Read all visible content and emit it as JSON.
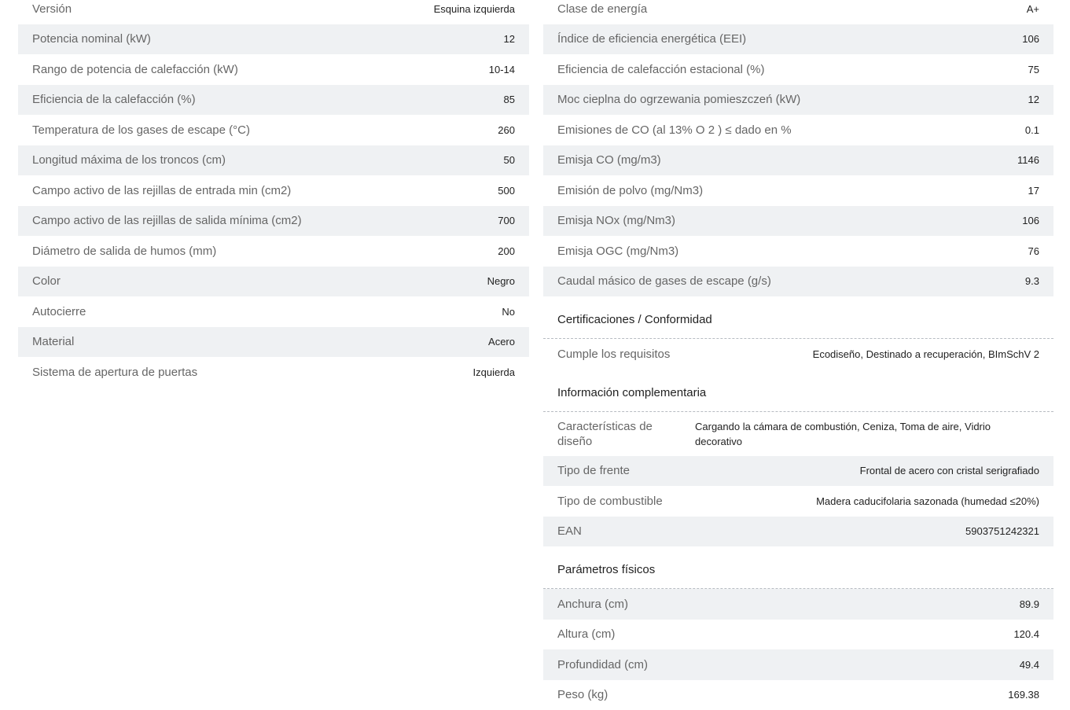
{
  "left_specs": [
    {
      "label": "Versión",
      "value": "Esquina izquierda"
    },
    {
      "label": "Potencia nominal (kW)",
      "value": "12"
    },
    {
      "label": "Rango de potencia de calefacción (kW)",
      "value": "10-14"
    },
    {
      "label": "Eficiencia de la calefacción (%)",
      "value": "85"
    },
    {
      "label": "Temperatura de los gases de escape (°C)",
      "value": "260"
    },
    {
      "label": "Longitud máxima de los troncos (cm)",
      "value": "50"
    },
    {
      "label": "Campo activo de las rejillas de entrada min (cm2)",
      "value": "500"
    },
    {
      "label": "Campo activo de las rejillas de salida mínima (cm2)",
      "value": "700"
    },
    {
      "label": "Diámetro de salida de humos (mm)",
      "value": "200"
    },
    {
      "label": "Color",
      "value": "Negro"
    },
    {
      "label": "Autocierre",
      "value": "No"
    },
    {
      "label": "Material",
      "value": "Acero"
    },
    {
      "label": "Sistema de apertura de puertas",
      "value": "Izquierda"
    }
  ],
  "right_specs": [
    {
      "label": "Clase de energía",
      "value": "A+"
    },
    {
      "label": "Índice de eficiencia energética (EEI)",
      "value": "106"
    },
    {
      "label": "Eficiencia de calefacción estacional (%)",
      "value": "75"
    },
    {
      "label": "Moc cieplna do ogrzewania pomieszczeń (kW)",
      "value": "12"
    },
    {
      "label": "Emisiones de CO (al 13% O 2 ) ≤ dado en %",
      "value": "0.1"
    },
    {
      "label": "Emisja CO (mg/m3)",
      "value": "1146"
    },
    {
      "label": "Emisión de polvo (mg/Nm3)",
      "value": "17"
    },
    {
      "label": "Emisja NOx (mg/Nm3)",
      "value": "106"
    },
    {
      "label": "Emisja OGC (mg/Nm3)",
      "value": "76"
    },
    {
      "label": "Caudal másico de gases de escape (g/s)",
      "value": "9.3"
    }
  ],
  "certifications": {
    "title": "Certificaciones / Conformidad",
    "rows": [
      {
        "label": "Cumple los requisitos",
        "value": "Ecodiseño, Destinado a recuperación, BImSchV 2"
      }
    ]
  },
  "complementary": {
    "title": "Información complementaria",
    "rows": [
      {
        "label": "Características de diseño",
        "value": "Cargando la cámara de combustión, Ceniza, Toma de aire, Vidrio decorativo"
      },
      {
        "label": "Tipo de frente",
        "value": "Frontal de acero con cristal serigrafiado"
      },
      {
        "label": "Tipo de combustible",
        "value": "Madera caducifolaria sazonada (humedad ≤20%)"
      },
      {
        "label": "EAN",
        "value": "5903751242321"
      }
    ]
  },
  "physical": {
    "title": "Parámetros físicos",
    "rows": [
      {
        "label": "Anchura (cm)",
        "value": "89.9"
      },
      {
        "label": "Altura (cm)",
        "value": "120.4"
      },
      {
        "label": "Profundidad (cm)",
        "value": "49.4"
      },
      {
        "label": "Peso (kg)",
        "value": "169.38"
      }
    ]
  }
}
